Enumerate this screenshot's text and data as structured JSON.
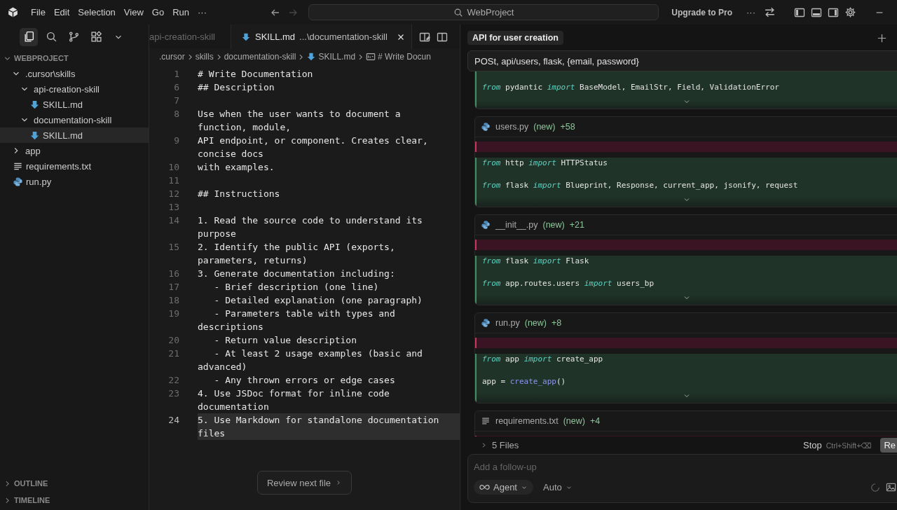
{
  "titlebar": {
    "menu": [
      "File",
      "Edit",
      "Selection",
      "View",
      "Go",
      "Run",
      "···"
    ],
    "search": "WebProject",
    "upgrade": "Upgrade to Pro",
    "more": "···"
  },
  "sidebar": {
    "views": [
      {
        "kind": "files",
        "selected": true
      },
      {
        "kind": "search",
        "selected": false
      },
      {
        "kind": "branch",
        "selected": false
      },
      {
        "kind": "extensions",
        "selected": false
      },
      {
        "kind": "more",
        "selected": false
      }
    ],
    "section": "WEBPROJECT",
    "tree": [
      {
        "label": ".cursor\\skills",
        "kind": "folder",
        "expanded": true,
        "selected": false,
        "children": [
          {
            "label": "api-creation-skill",
            "kind": "folder",
            "expanded": true,
            "selected": false,
            "children": [
              {
                "label": "SKILL.md",
                "kind": "markdown",
                "selected": false
              }
            ]
          },
          {
            "label": "documentation-skill",
            "kind": "folder",
            "expanded": true,
            "selected": false,
            "children": [
              {
                "label": "SKILL.md",
                "kind": "markdown",
                "selected": true
              }
            ]
          }
        ]
      },
      {
        "label": "app",
        "kind": "folder",
        "expanded": false,
        "selected": false
      },
      {
        "label": "requirements.txt",
        "kind": "text",
        "selected": false
      },
      {
        "label": "run.py",
        "kind": "python",
        "selected": false
      }
    ],
    "bottom_sections": [
      {
        "label": "OUTLINE",
        "expanded": false
      },
      {
        "label": "TIMELINE",
        "expanded": false
      }
    ]
  },
  "editor": {
    "tabs": [
      {
        "label": "api-creation-skill",
        "selected": false
      },
      {
        "label": "SKILL.md",
        "detail": "...\\documentation-skill",
        "kind": "markdown",
        "selected": true
      }
    ],
    "breadcrumb": [
      {
        "label": ".cursor",
        "kind": "folder"
      },
      {
        "label": "skills",
        "kind": "folder"
      },
      {
        "label": "documentation-skill",
        "kind": "folder"
      },
      {
        "label": "SKILL.md",
        "kind": "markdown"
      },
      {
        "label": "# Write Docun",
        "kind": "symbol"
      }
    ],
    "lines": [
      {
        "number": "1",
        "text": "# Write Documentation",
        "selected": false
      },
      {
        "number": "6",
        "text": "## Description",
        "selected": false
      },
      {
        "number": "7",
        "selected": false
      },
      {
        "number": "8",
        "text": "Use when the user wants to document a function, module,",
        "selected": false
      },
      {
        "number": "9",
        "text": "API endpoint, or component. Creates clear, concise docs",
        "selected": false
      },
      {
        "number": "10",
        "text": "with examples.",
        "selected": false
      },
      {
        "number": "11",
        "selected": false
      },
      {
        "number": "12",
        "text": "## Instructions",
        "selected": false
      },
      {
        "number": "13",
        "selected": false
      },
      {
        "number": "14",
        "text": "1. Read the source code to understand its purpose",
        "selected": false
      },
      {
        "number": "15",
        "text": "2. Identify the public API (exports, parameters, returns)",
        "selected": false
      },
      {
        "number": "16",
        "text": "3. Generate documentation including:",
        "selected": false
      },
      {
        "number": "17",
        "text": "   - Brief description (one line)",
        "selected": false
      },
      {
        "number": "18",
        "text": "   - Detailed explanation (one paragraph)",
        "selected": false
      },
      {
        "number": "19",
        "text": "   - Parameters table with types and descriptions",
        "selected": false
      },
      {
        "number": "20",
        "text": "   - Return value description",
        "selected": false
      },
      {
        "number": "21",
        "text": "   - At least 2 usage examples (basic and advanced)",
        "selected": false
      },
      {
        "number": "22",
        "text": "   - Any thrown errors or edge cases",
        "selected": false
      },
      {
        "number": "23",
        "text": "4. Use JSDoc format for inline code documentation",
        "selected": false
      },
      {
        "number": "24",
        "text": "5. Use Markdown for standalone documentation files",
        "selected": true
      }
    ],
    "review_button": "Review next file"
  },
  "chat": {
    "tab": "API for user creation",
    "prompt": "POSt, api/users, flask, {email, password}",
    "cards": [
      {
        "deleted_line": false,
        "lines": [
          [
            {
              "kind": "keyword",
              "text": "from"
            },
            {
              "kind": "plain",
              "text": " pydantic "
            },
            {
              "kind": "keyword",
              "text": "import"
            },
            {
              "kind": "plain",
              "text": " BaseModel, EmailStr, Field, ValidationError"
            }
          ]
        ]
      },
      {
        "file": "users.py",
        "kind": "python",
        "status": "(new)",
        "added": "+58",
        "deleted_line": true,
        "lines": [
          [
            {
              "kind": "keyword",
              "text": "from"
            },
            {
              "kind": "plain",
              "text": " http "
            },
            {
              "kind": "keyword",
              "text": "import"
            },
            {
              "kind": "plain",
              "text": " HTTPStatus"
            }
          ],
          [
            {
              "kind": "keyword",
              "text": "from"
            },
            {
              "kind": "plain",
              "text": " flask "
            },
            {
              "kind": "keyword",
              "text": "import"
            },
            {
              "kind": "plain",
              "text": " Blueprint, Response, current_app, jsonify, request"
            }
          ]
        ]
      },
      {
        "file": "__init__.py",
        "kind": "python",
        "status": "(new)",
        "added": "+21",
        "deleted_line": true,
        "lines": [
          [
            {
              "kind": "keyword",
              "text": "from"
            },
            {
              "kind": "plain",
              "text": " flask "
            },
            {
              "kind": "keyword",
              "text": "import"
            },
            {
              "kind": "plain",
              "text": " Flask"
            }
          ],
          [
            {
              "kind": "keyword",
              "text": "from"
            },
            {
              "kind": "plain",
              "text": " app.routes.users "
            },
            {
              "kind": "keyword",
              "text": "import"
            },
            {
              "kind": "plain",
              "text": " users_bp"
            }
          ]
        ]
      },
      {
        "file": "run.py",
        "kind": "python",
        "status": "(new)",
        "added": "+8",
        "deleted_line": true,
        "lines": [
          [
            {
              "kind": "keyword",
              "text": "from"
            },
            {
              "kind": "plain",
              "text": " app "
            },
            {
              "kind": "keyword",
              "text": "import"
            },
            {
              "kind": "plain",
              "text": " create_app"
            }
          ],
          [
            {
              "kind": "plain",
              "text": "app = "
            },
            {
              "kind": "call",
              "text": "create_app"
            },
            {
              "kind": "plain",
              "text": "()"
            }
          ]
        ]
      },
      {
        "file": "requirements.txt",
        "kind": "text",
        "status": "(new)",
        "added": "+4",
        "deleted_line": true
      }
    ],
    "files_summary": "5 Files",
    "stop": "Stop",
    "stop_shortcut": "Ctrl+Shift+⌫",
    "cut_button": "Re",
    "followup_placeholder": "Add a follow-up",
    "mode": "Agent",
    "model": "Auto"
  }
}
